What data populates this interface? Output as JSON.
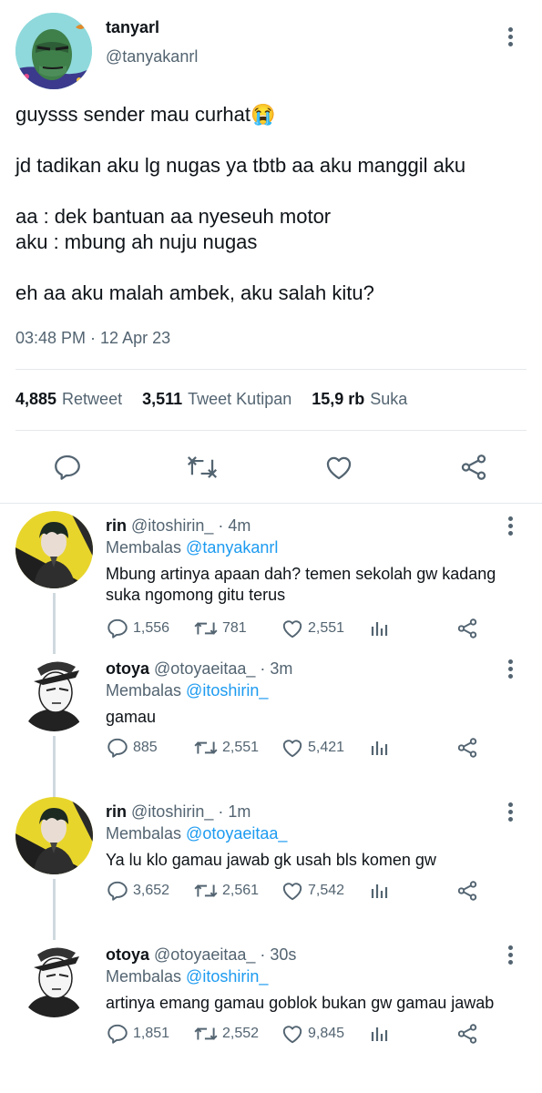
{
  "tweet": {
    "display_name": "tanyarl",
    "handle": "@tanyakanrl",
    "text_lines": [
      "guysss sender mau curhat😭",
      "jd tadikan aku lg nugas ya tbtb aa aku manggil aku",
      "aa : dek bantuan aa nyeseuh motor",
      "aku : mbung ah nuju nugas",
      "eh aa aku malah ambek, aku salah kitu?"
    ],
    "timestamp": "03:48 PM · 12 Apr 23",
    "stats": {
      "retweets_count": "4,885",
      "retweets_label": "Retweet",
      "quotes_count": "3,511",
      "quotes_label": "Tweet Kutipan",
      "likes_count": "15,9 rb",
      "likes_label": "Suka"
    },
    "action_icons": [
      "reply-icon",
      "retweet-icon",
      "like-icon",
      "share-icon"
    ]
  },
  "replies": [
    {
      "name": "rin",
      "handle_time": "@itoshirin_ · 4m",
      "replying_label": "Membalas",
      "replying_to": "@tanyakanrl",
      "text": "Mbung artinya apaan dah? temen sekolah gw kadang suka ngomong gitu terus",
      "replies": "1,556",
      "retweets": "781",
      "likes": "2,551"
    },
    {
      "name": "otoya",
      "handle_time": "@otoyaeitaa_ · 3m",
      "replying_label": "Membalas",
      "replying_to": "@itoshirin_",
      "text": "gamau",
      "replies": "885",
      "retweets": "2,551",
      "likes": "5,421"
    },
    {
      "name": "rin",
      "handle_time": "@itoshirin_ · 1m",
      "replying_label": "Membalas",
      "replying_to": "@otoyaeitaa_",
      "text": "Ya lu klo gamau jawab gk usah bls komen gw",
      "replies": "3,652",
      "retweets": "2,561",
      "likes": "7,542"
    },
    {
      "name": "otoya",
      "handle_time": "@otoyaeitaa_ · 30s",
      "replying_label": "Membalas",
      "replying_to": "@itoshirin_",
      "text": "artinya emang gamau goblok bukan gw gamau jawab",
      "replies": "1,851",
      "retweets": "2,552",
      "likes": "9,845"
    }
  ],
  "colors": {
    "accent": "#1d9bf0",
    "secondary_text": "#536471",
    "primary_text": "#0f1419",
    "divider": "#e5e9ec"
  }
}
